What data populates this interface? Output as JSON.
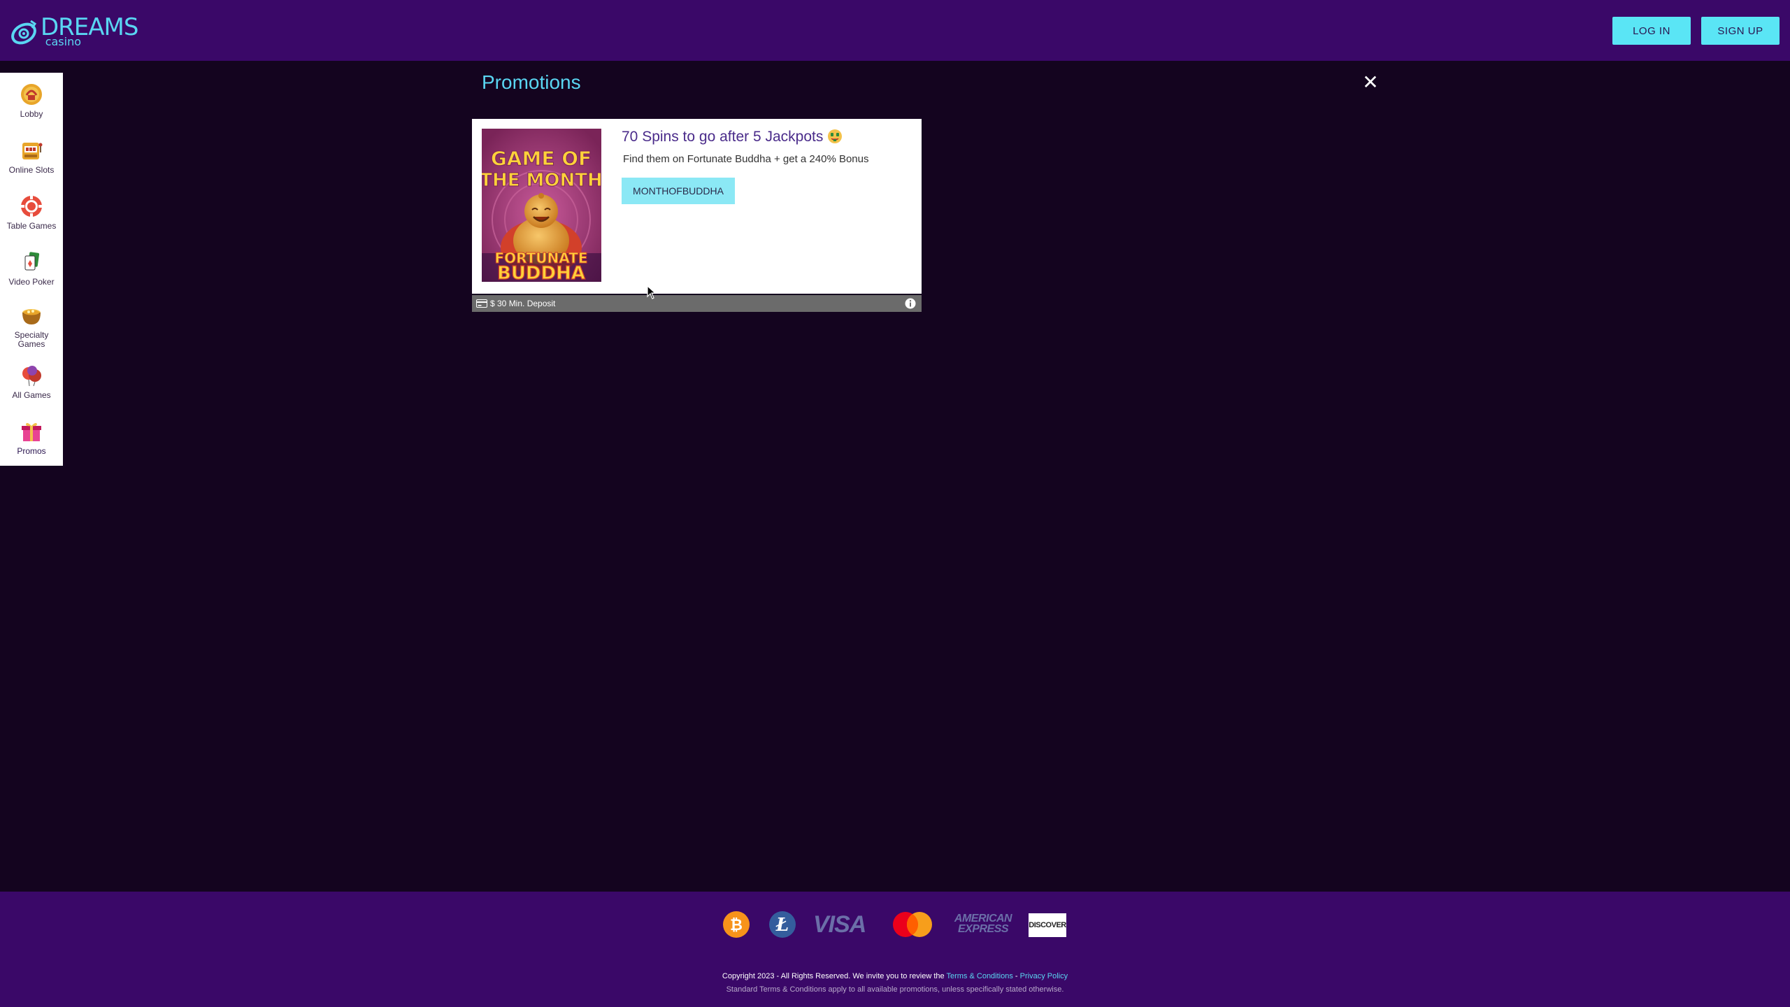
{
  "brand": {
    "logo_text": "DREAMS",
    "logo_subtext": "casino",
    "colors": {
      "header_bg": "#3a0868",
      "page_bg": "#14041f",
      "accent": "#5ad6f2",
      "button_bg": "#5ae5f5"
    }
  },
  "header": {
    "login_label": "LOG IN",
    "signup_label": "SIGN UP"
  },
  "sidebar": {
    "items": [
      {
        "label": "Lobby",
        "icon": "lobby-icon"
      },
      {
        "label": "Online Slots",
        "icon": "slot-machine-icon"
      },
      {
        "label": "Table Games",
        "icon": "poker-chip-icon"
      },
      {
        "label": "Video Poker",
        "icon": "playing-cards-icon"
      },
      {
        "label": "Specialty Games",
        "icon": "pot-of-coins-icon"
      },
      {
        "label": "All Games",
        "icon": "balloons-icon"
      },
      {
        "label": "Promos",
        "icon": "gift-icon"
      }
    ]
  },
  "main": {
    "title": "Promotions",
    "close_icon": "close-icon"
  },
  "promo": {
    "image": {
      "line1": "GAME OF",
      "line2": "THE MONTH",
      "game_word1": "FORTUNATE",
      "game_word2": "BUDDHA"
    },
    "headline": "70 Spins to go after 5 Jackpots",
    "headline_emoji": "money-face-icon",
    "description": "Find them on Fortunate Buddha + get a 240% Bonus",
    "code": "MONTHOFBUDDHA",
    "min_deposit": "$ 30 Min. Deposit"
  },
  "footer": {
    "payment_methods": [
      "bitcoin-icon",
      "litecoin-icon",
      "VISA",
      "mastercard-icon",
      "AMERICAN EXPRESS",
      "DISCOVER"
    ],
    "copyright_prefix": "Copyright 2023 - All Rights Reserved. We invite you to review the ",
    "terms_link": "Terms & Conditions",
    "separator": " - ",
    "privacy_link": "Privacy Policy",
    "standard_terms": "Standard Terms & Conditions apply to all available promotions, unless specifically stated otherwise."
  }
}
